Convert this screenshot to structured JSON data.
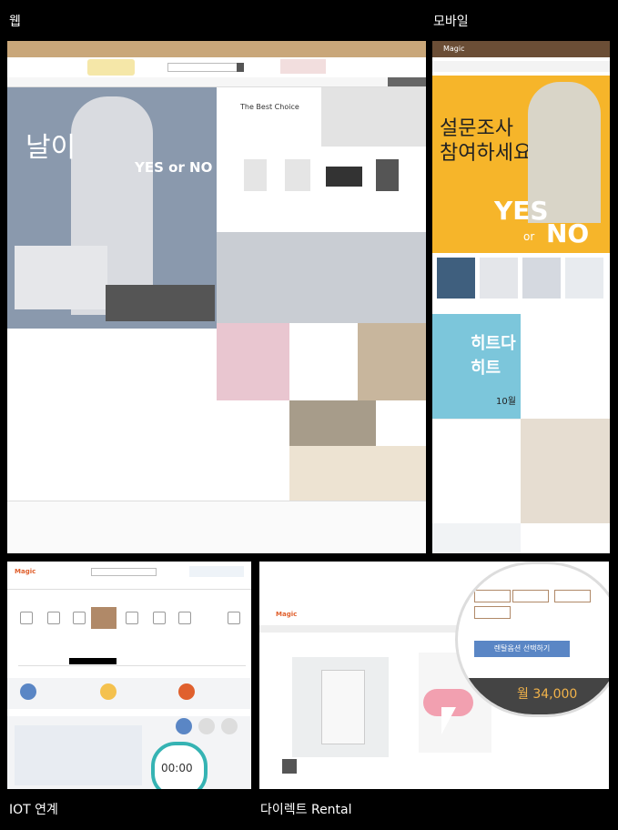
{
  "labels": {
    "web": "웹",
    "mobile": "모바일",
    "iot": "IOT 연계",
    "rental": "다이렉트 Rental"
  },
  "web": {
    "hero_text": "날이",
    "hero_yesno": "YES or NO",
    "section_title": "The Best Choice"
  },
  "mobile": {
    "brand": "Magic",
    "survey_line1": "설문조사",
    "survey_line2": "참여하세요!",
    "yes": "YES",
    "or": "or",
    "no": "NO",
    "hit_line1": "히트다",
    "hit_line2": "히트",
    "month": "10월"
  },
  "iot": {
    "brand": "Magic",
    "timer": "00:00"
  },
  "rental": {
    "brand": "Magic",
    "button": "렌탈옵션 선택하기",
    "price": "월 34,000"
  },
  "colors": {
    "bg": "#000000",
    "yellow": "#f6b52a",
    "accent_blue": "#5a86c5",
    "iot_teal": "#35b3b3"
  }
}
